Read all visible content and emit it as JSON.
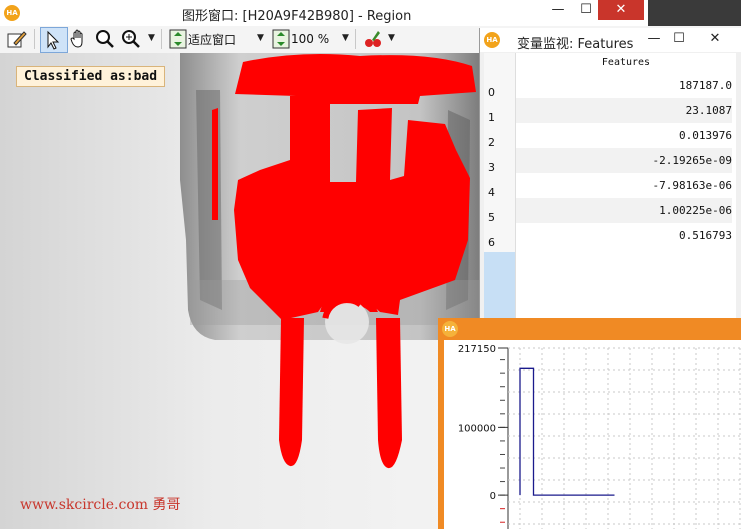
{
  "main_window": {
    "title": "图形窗口: [H20A9F42B980] - Region",
    "logo": "HA",
    "controls": {
      "minimize": "—",
      "maximize": "☐",
      "close": "✕"
    }
  },
  "toolbar": {
    "fit_window_label": "适应窗口",
    "zoom_label": "100 %",
    "icons": [
      "edit-icon",
      "pointer-icon",
      "hand-icon",
      "magnifier-icon",
      "zoom-in-icon",
      "fit-window-icon",
      "zoom-icon",
      "paint-icon"
    ]
  },
  "canvas": {
    "classified_label": "Classified as:bad",
    "watermark": "www.skcircle.com 勇哥",
    "region_color": "#ff0000"
  },
  "variable_window": {
    "title": "变量监视: Features",
    "logo": "HA",
    "controls": {
      "minimize": "—",
      "maximize": "☐",
      "close": "✕"
    },
    "column_header": "Features",
    "rows": [
      {
        "index": "0",
        "value": "187187.0"
      },
      {
        "index": "1",
        "value": "23.1087"
      },
      {
        "index": "2",
        "value": "0.013976"
      },
      {
        "index": "3",
        "value": "-2.19265e-09"
      },
      {
        "index": "4",
        "value": "-7.98163e-06"
      },
      {
        "index": "5",
        "value": "1.00225e-06"
      },
      {
        "index": "6",
        "value": "0.516793"
      }
    ],
    "footer_mark": "+"
  },
  "plot_window": {
    "logo": "HA",
    "accent_color": "#f08a24"
  },
  "chart_data": {
    "type": "line",
    "y_tick_labels": [
      "217150",
      "100000",
      "0"
    ],
    "series": [
      {
        "x": [
          0,
          0,
          1,
          1,
          7
        ],
        "y": [
          0,
          187187,
          187187,
          0,
          0
        ]
      }
    ],
    "ylim": [
      -50000,
      217150
    ],
    "grid": true
  }
}
